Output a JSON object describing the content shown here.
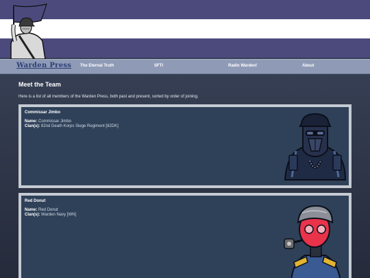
{
  "nav": {
    "brand": "Warden Press",
    "links": [
      "The Eternal Truth",
      "SFTI",
      "Radio Warden!",
      "About"
    ]
  },
  "page": {
    "title": "Meet the Team",
    "intro": "Here is a list of all members of the Warden Press, both past and present, sorted by order of joining."
  },
  "labels": {
    "name": "Name:",
    "clans": "Clan(s):"
  },
  "members": [
    {
      "heading": "Commissar Jimbo",
      "name": "Commissar Jimbo",
      "clans": "82nd Death Korps Siege Regiment [82DK]"
    },
    {
      "heading": "Red Donut",
      "name": "Red Donut",
      "clans": "Warden Navy [WN]"
    }
  ],
  "colors": {
    "banner_purple": "#4c4a7d",
    "nav_bar": "#8f9bb6",
    "card_bg": "#2f4159",
    "card_border": "#c5cbd2",
    "brand_blue": "#2c3e74"
  },
  "icons": {
    "logo": "soldier-with-flag-icon",
    "member_1": "gas-mask-soldier-portrait",
    "member_2": "red-donut-portrait"
  }
}
